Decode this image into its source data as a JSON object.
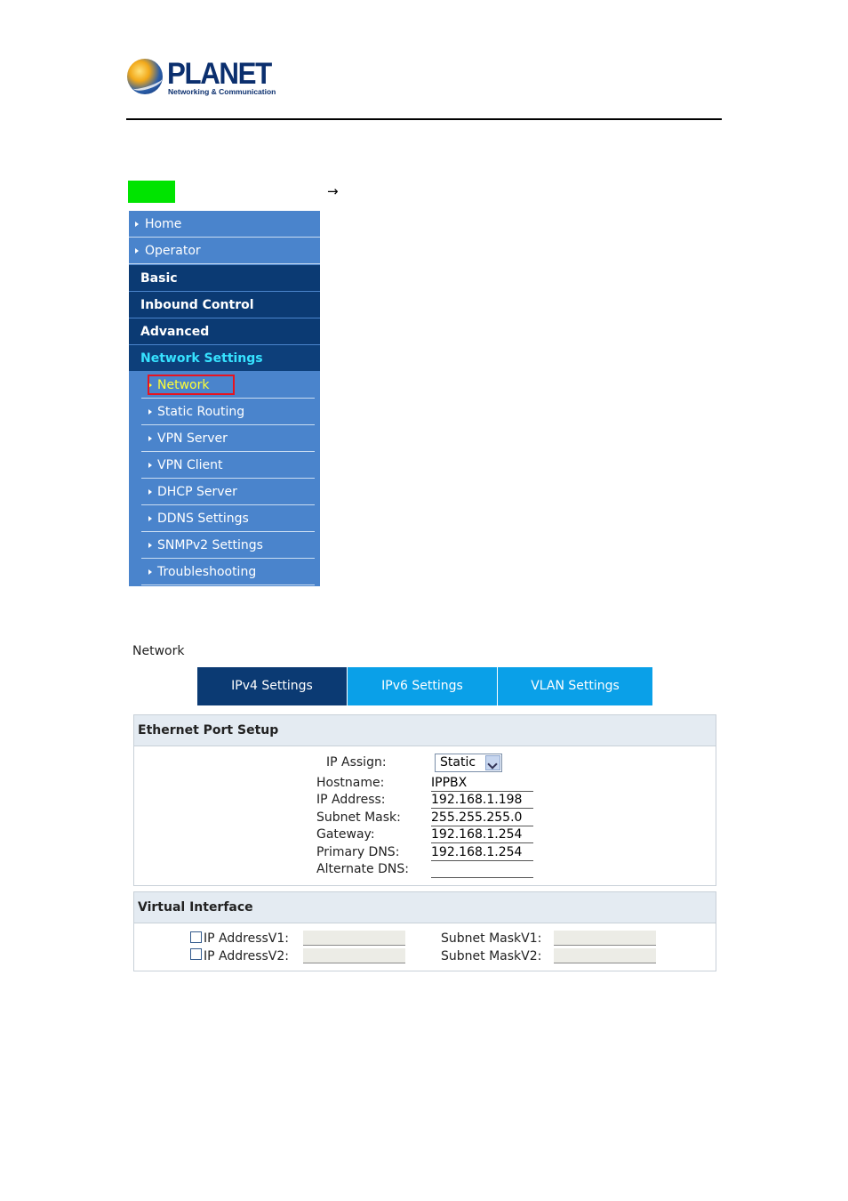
{
  "brand": {
    "name": "PLANET",
    "tagline": "Networking & Communication"
  },
  "breadcrumb": {
    "arrow": "→"
  },
  "colors": {
    "sidebar_bg": "#4a84cc",
    "sidebar_header": "#0b3a73",
    "active_header_text": "#36e2ff",
    "selected_item_text": "#ffff33",
    "highlight_box": "#e8131f",
    "tab_active": "#0b3a73",
    "tab_inactive": "#0aa0e8",
    "swatch": "#00e400"
  },
  "sidebar": {
    "top_items": [
      "Home",
      "Operator"
    ],
    "headers": [
      "Basic",
      "Inbound Control",
      "Advanced",
      "Network Settings"
    ],
    "active_header": "Network Settings",
    "sub_items": [
      "Network",
      "Static Routing",
      "VPN Server",
      "VPN Client",
      "DHCP Server",
      "DDNS Settings",
      "SNMPv2 Settings",
      "Troubleshooting"
    ],
    "selected_sub_item": "Network"
  },
  "panel": {
    "title": "Network",
    "tabs": [
      "IPv4 Settings",
      "IPv6 Settings",
      "VLAN Settings"
    ],
    "active_tab": "IPv4 Settings"
  },
  "ethernet": {
    "heading": "Ethernet Port Setup",
    "ip_assign_label": "IP Assign:",
    "ip_assign_value": "Static",
    "fields": [
      {
        "label": "Hostname:",
        "value": "IPPBX"
      },
      {
        "label": "IP Address:",
        "value": "192.168.1.198"
      },
      {
        "label": "Subnet Mask:",
        "value": "255.255.255.0"
      },
      {
        "label": "Gateway:",
        "value": "192.168.1.254"
      },
      {
        "label": "Primary DNS:",
        "value": "192.168.1.254"
      },
      {
        "label": "Alternate DNS:",
        "value": ""
      }
    ]
  },
  "virtual": {
    "heading": "Virtual Interface",
    "rows": [
      {
        "ip_label": "IP AddressV1:",
        "mask_label": "Subnet MaskV1:",
        "checked": false
      },
      {
        "ip_label": "IP AddressV2:",
        "mask_label": "Subnet MaskV2:",
        "checked": false
      }
    ]
  }
}
